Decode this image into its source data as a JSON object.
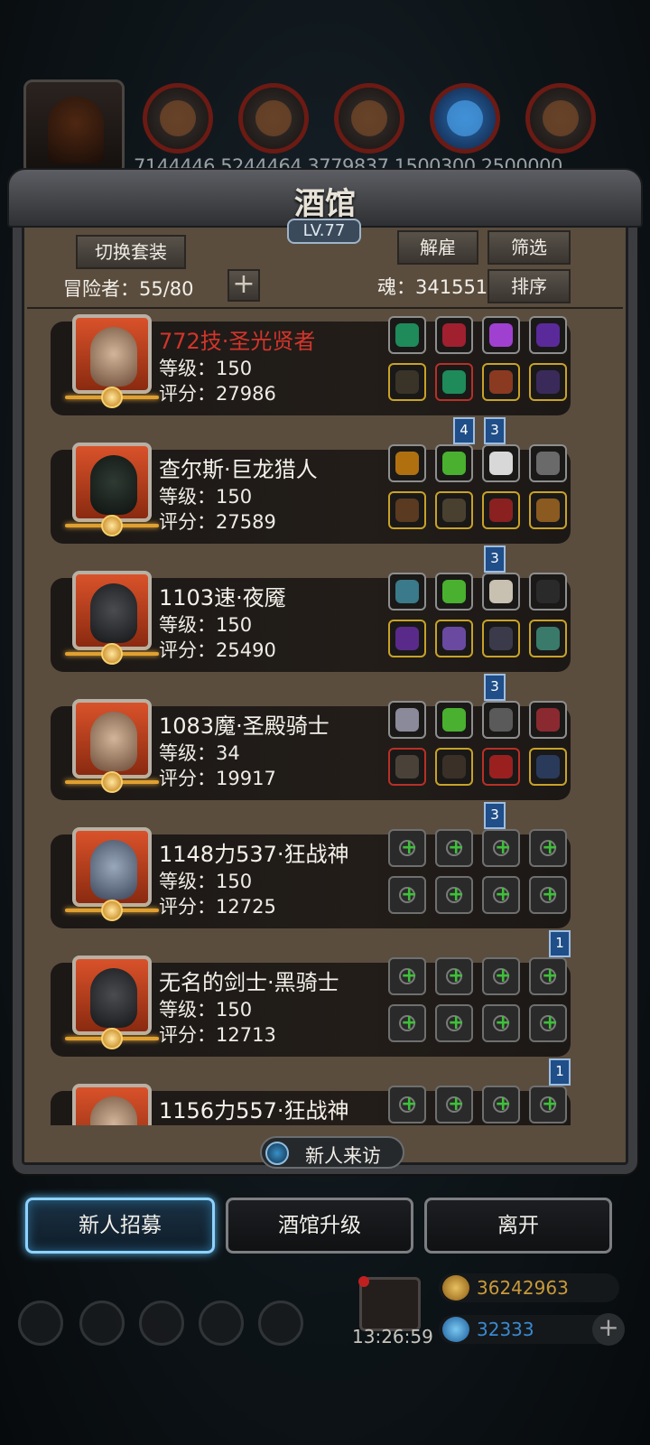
{
  "resources": {
    "values_text": "7144446  5244464  3779837  1500300  2500000"
  },
  "tavern": {
    "title": "酒馆",
    "level": "LV.77",
    "switch_outfit_label": "切换套装",
    "dismiss_label": "解雇",
    "filter_label": "筛选",
    "sort_label": "排序",
    "add_label": "+",
    "adventurers_text": "冒险者：55/80",
    "soul_text": "魂：341551"
  },
  "heroes": [
    {
      "name": "772技·圣光贤者",
      "name_color": "#d2352b",
      "level": "等级：150",
      "score": "评分：27986"
    },
    {
      "name": "查尔斯·巨龙猎人",
      "level": "等级：150",
      "score": "评分：27589"
    },
    {
      "name": "1103速·夜魇",
      "level": "等级：150",
      "score": "评分：25490"
    },
    {
      "name": "1083魔·圣殿骑士",
      "level": "等级：34",
      "score": "评分：19917"
    },
    {
      "name": "1148力537·狂战神",
      "level": "等级：150",
      "score": "评分：12725"
    },
    {
      "name": "无名的剑士·黑骑士",
      "level": "等级：150",
      "score": "评分：12713"
    },
    {
      "name": "1156力557·狂战神"
    }
  ],
  "set_tags": [
    "4",
    "3",
    "3",
    "3",
    "3",
    "1",
    "1"
  ],
  "visitor_label": "新人来访",
  "actions": {
    "recruit": "新人招募",
    "upgrade": "酒馆升级",
    "leave": "离开"
  },
  "timer": "13:26:59",
  "currency": {
    "gold": "36242963",
    "gem": "32333"
  },
  "colors": {
    "accent": "#8fd2ff",
    "name_highlight": "#d2352b",
    "tag_blue": "#1f4e88"
  }
}
